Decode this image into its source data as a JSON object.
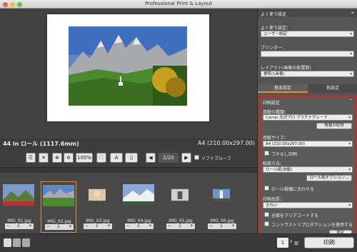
{
  "window": {
    "title": "Professional Print & Layout"
  },
  "preview": {
    "roll_size": "44 in ロール (1117.6mm)",
    "paper_size": "A4 (210.00x297.00)"
  },
  "toolbar": {
    "zoom": "100%",
    "page": "2/20",
    "softproof_label": "ソフトプルーフ"
  },
  "thumbnails": [
    {
      "name": "IMG_01.jpg",
      "copies": "1"
    },
    {
      "name": "IMG_02.jpg",
      "copies": "1"
    },
    {
      "name": "IMG_03.jpg",
      "copies": "1"
    },
    {
      "name": "IMG_04.jpg",
      "copies": "1"
    },
    {
      "name": "IMG_05.jpg",
      "copies": "1"
    },
    {
      "name": "IMG_06.jpg",
      "copies": "1"
    }
  ],
  "bottom": {
    "copies_value": "1",
    "copies_unit": "部",
    "print_button": "印刷"
  },
  "panel": {
    "header": "よく使う設定",
    "favorite_label": "よく使う設定：",
    "favorite_value": "ユーザー設定",
    "printer_label": "プリンター：",
    "layout_label": "レイアウト(画像の配置数)",
    "layout_value": "標準(1画像)",
    "tab_basic": "基本設定",
    "tab_color": "色設定",
    "print_settings_header": "印刷設定",
    "media_label": "用紙の種類：",
    "media_value": "Canon 光沢プロ プラチナグレード",
    "get_info_button": "情報の取得",
    "paper_size_label": "用紙サイズ：",
    "paper_size_value": "A4 (210.00x297.00)",
    "borderless_label": "フチなし印刷",
    "feed_label": "給紙方法：",
    "feed_value": "ロール紙(自動)",
    "roll_options_button": "ロール紙オプション...",
    "fit_roll_label": "ロール紙幅に合わせる",
    "quality_label": "印刷品質：",
    "quality_value": "きれい",
    "clear_coat_label": "全面をクリアコートする",
    "contrast_label": "コントラストリプロダクションを使用する",
    "settings_button": "設定"
  },
  "colors": {
    "accent_red": "#e02020",
    "window_bg": "#3a3a3a"
  }
}
